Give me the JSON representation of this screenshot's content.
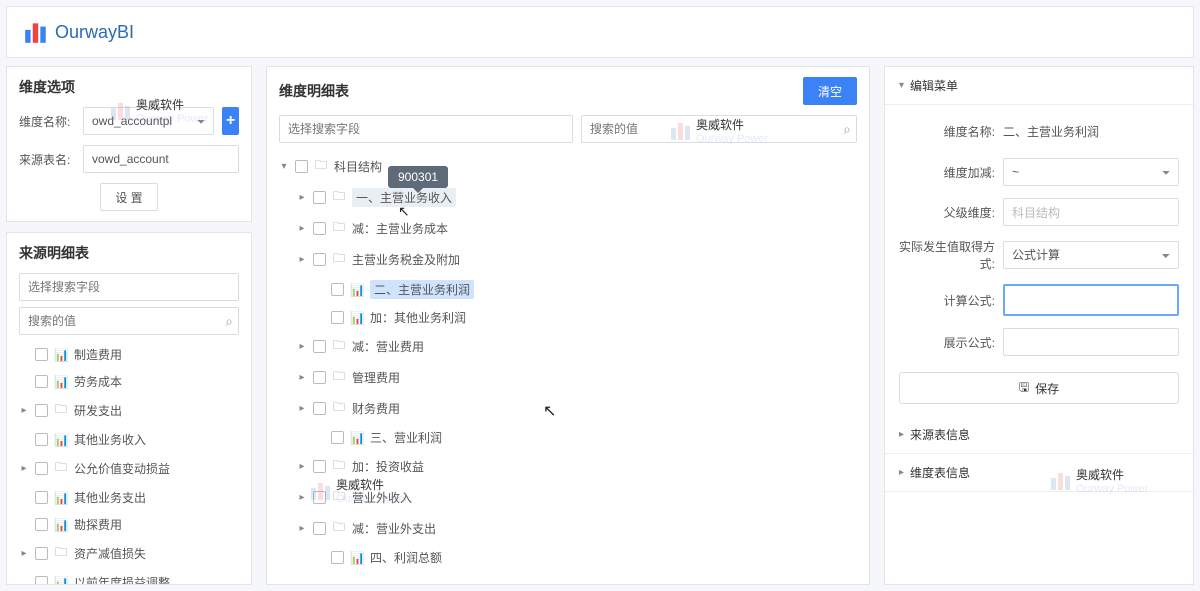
{
  "app": {
    "name": "OurwayBI"
  },
  "watermark": {
    "text": "奥威软件",
    "sub": "Ourway Power"
  },
  "left": {
    "opts_title": "维度选项",
    "name_label": "维度名称:",
    "name_value": "owd_accountpl",
    "src_label": "来源表名:",
    "src_value": "vowd_account",
    "settings_btn": "设 置",
    "detail_title": "来源明细表",
    "search_field_ph": "选择搜索字段",
    "search_value_ph": "搜索的值",
    "items": [
      {
        "label": "制造费用",
        "icon": "chart"
      },
      {
        "label": "劳务成本",
        "icon": "chart"
      },
      {
        "label": "研发支出",
        "icon": "folder",
        "caret": true
      },
      {
        "label": "其他业务收入",
        "icon": "chart"
      },
      {
        "label": "公允价值变动损益",
        "icon": "folder",
        "caret": true
      },
      {
        "label": "其他业务支出",
        "icon": "chart"
      },
      {
        "label": "勘探费用",
        "icon": "chart"
      },
      {
        "label": "资产减值损失",
        "icon": "folder",
        "caret": true
      },
      {
        "label": "以前年度损益调整",
        "icon": "chart"
      }
    ]
  },
  "center": {
    "title": "维度明细表",
    "clear_btn": "清空",
    "search_field_ph": "选择搜索字段",
    "search_value_ph": "搜索的值",
    "tooltip": "900301",
    "tree": [
      {
        "label": "科目结构",
        "icon": "folder",
        "caret": true,
        "open": true,
        "indent": 0
      },
      {
        "label": "一、主营业务收入",
        "icon": "folder",
        "caret": true,
        "indent": 1,
        "hl": true
      },
      {
        "label": "减：主营业务成本",
        "icon": "folder",
        "caret": true,
        "indent": 1
      },
      {
        "label": "主营业务税金及附加",
        "icon": "folder",
        "caret": true,
        "indent": 1
      },
      {
        "label": "二、主营业务利润",
        "icon": "chart",
        "indent": 2,
        "sel": true
      },
      {
        "label": "加：其他业务利润",
        "icon": "chart",
        "indent": 2
      },
      {
        "label": "减：营业费用",
        "icon": "folder",
        "caret": true,
        "indent": 1
      },
      {
        "label": "管理费用",
        "icon": "folder",
        "caret": true,
        "indent": 1
      },
      {
        "label": "财务费用",
        "icon": "folder",
        "caret": true,
        "indent": 1
      },
      {
        "label": "三、营业利润",
        "icon": "chart",
        "indent": 2
      },
      {
        "label": "加：投资收益",
        "icon": "folder",
        "caret": true,
        "indent": 1
      },
      {
        "label": "营业外收入",
        "icon": "folder",
        "caret": true,
        "indent": 1
      },
      {
        "label": "减：营业外支出",
        "icon": "folder",
        "caret": true,
        "indent": 1
      },
      {
        "label": "四、利润总额",
        "icon": "chart",
        "indent": 2
      }
    ]
  },
  "right": {
    "acc1": "编辑菜单",
    "acc2": "来源表信息",
    "acc3": "维度表信息",
    "dim_name_label": "维度名称:",
    "dim_name_value": "二、主营业务利润",
    "dim_op_label": "维度加减:",
    "dim_op_value": "~",
    "parent_label": "父级维度:",
    "parent_value": "科目结构",
    "method_label": "实际发生值取得方式:",
    "method_value": "公式计算",
    "calc_label": "计算公式:",
    "show_label": "展示公式:",
    "save_btn": "保存"
  }
}
